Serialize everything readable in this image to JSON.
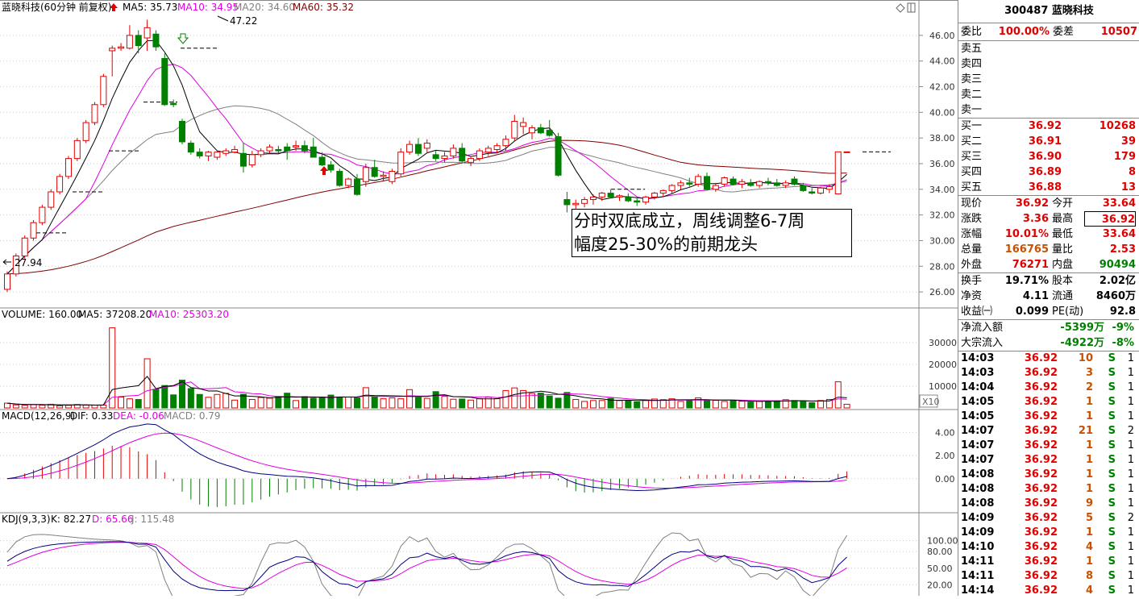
{
  "main_chart": {
    "title": "蓝晓科技(60分钟 前复权)",
    "ma5": "MA5: 35.73",
    "ma10": "MA10: 34.95",
    "ma20": "MA20: 34.60",
    "ma60": "MA60: 35.32",
    "high_label": "47.22",
    "low_label": "27.94",
    "y_ticks": [
      "46.00",
      "44.00",
      "42.00",
      "40.00",
      "38.00",
      "36.00",
      "34.00",
      "32.00",
      "30.00",
      "28.00",
      "26.00"
    ],
    "annotation_line1": "分时双底成立，周线调整6-7周",
    "annotation_line2": "幅度25-30%的前期龙头"
  },
  "volume_chart": {
    "title": "VOLUME: 160.00",
    "ma5": "MA5: 37208.20",
    "ma10": "MA10: 25303.20",
    "y_ticks": [
      "30000",
      "20000",
      "10000"
    ],
    "unit": "X10"
  },
  "macd_chart": {
    "title": "MACD(12,26,9)",
    "dif": "DIF: 0.33",
    "dea": "DEA: -0.06",
    "macd": "MACD: 0.79",
    "y_ticks": [
      "4.00",
      "2.00",
      "0.00"
    ]
  },
  "kdj_chart": {
    "title": "KDJ(9,3,3)",
    "k": "K: 82.27",
    "d": "D: 65.66",
    "j": "J: 115.48",
    "y_ticks": [
      "100.00",
      "80.00",
      "50.00",
      "20.00"
    ]
  },
  "quote": {
    "header": "300487 蓝晓科技",
    "weibi_label": "委比",
    "weibi": "100.00%",
    "weicha_label": "委差",
    "weicha": "10507",
    "asks": [
      {
        "label": "卖五",
        "price": "",
        "vol": ""
      },
      {
        "label": "卖四",
        "price": "",
        "vol": ""
      },
      {
        "label": "卖三",
        "price": "",
        "vol": ""
      },
      {
        "label": "卖二",
        "price": "",
        "vol": ""
      },
      {
        "label": "卖一",
        "price": "",
        "vol": ""
      }
    ],
    "bids": [
      {
        "label": "买一",
        "price": "36.92",
        "vol": "10268"
      },
      {
        "label": "买二",
        "price": "36.91",
        "vol": "39"
      },
      {
        "label": "买三",
        "price": "36.90",
        "vol": "179"
      },
      {
        "label": "买四",
        "price": "36.89",
        "vol": "8"
      },
      {
        "label": "买五",
        "price": "36.88",
        "vol": "13"
      }
    ],
    "stats": [
      {
        "l1": "现价",
        "v1": "36.92",
        "l2": "今开",
        "v2": "33.64",
        "c1": "red",
        "c2": "red"
      },
      {
        "l1": "涨跌",
        "v1": "3.36",
        "l2": "最高",
        "v2": "36.92",
        "c1": "red",
        "c2": "red"
      },
      {
        "l1": "涨幅",
        "v1": "10.01%",
        "l2": "最低",
        "v2": "33.64",
        "c1": "red",
        "c2": "red"
      },
      {
        "l1": "总量",
        "v1": "166765",
        "l2": "量比",
        "v2": "2.53",
        "c1": "orange",
        "c2": "red"
      },
      {
        "l1": "外盘",
        "v1": "76271",
        "l2": "内盘",
        "v2": "90494",
        "c1": "red",
        "c2": "green"
      }
    ],
    "fund": [
      {
        "l1": "换手",
        "v1": "19.71%",
        "l2": "股本",
        "v2": "2.02亿"
      },
      {
        "l1": "净资",
        "v1": "4.11",
        "l2": "流通",
        "v2": "8460万"
      },
      {
        "l1": "收益㈠",
        "v1": "0.099",
        "l2": "PE(动)",
        "v2": "92.8"
      }
    ],
    "flow": [
      {
        "label": "净流入额",
        "value": "-5399万",
        "pct": "-9%"
      },
      {
        "label": "大宗流入",
        "value": "-4922万",
        "pct": "-8%"
      }
    ],
    "ticks": [
      {
        "time": "14:03",
        "price": "36.92",
        "vol": "10",
        "side": "S",
        "n": "1"
      },
      {
        "time": "14:03",
        "price": "36.92",
        "vol": "3",
        "side": "S",
        "n": "1"
      },
      {
        "time": "14:04",
        "price": "36.92",
        "vol": "2",
        "side": "S",
        "n": "1"
      },
      {
        "time": "14:05",
        "price": "36.92",
        "vol": "1",
        "side": "S",
        "n": "1"
      },
      {
        "time": "14:05",
        "price": "36.92",
        "vol": "1",
        "side": "S",
        "n": "1"
      },
      {
        "time": "14:07",
        "price": "36.92",
        "vol": "21",
        "side": "S",
        "n": "2"
      },
      {
        "time": "14:07",
        "price": "36.92",
        "vol": "1",
        "side": "S",
        "n": "1"
      },
      {
        "time": "14:07",
        "price": "36.92",
        "vol": "1",
        "side": "S",
        "n": "1"
      },
      {
        "time": "14:08",
        "price": "36.92",
        "vol": "1",
        "side": "S",
        "n": "1"
      },
      {
        "time": "14:08",
        "price": "36.92",
        "vol": "1",
        "side": "S",
        "n": "1"
      },
      {
        "time": "14:08",
        "price": "36.92",
        "vol": "9",
        "side": "S",
        "n": "1"
      },
      {
        "time": "14:09",
        "price": "36.92",
        "vol": "5",
        "side": "S",
        "n": "2"
      },
      {
        "time": "14:09",
        "price": "36.92",
        "vol": "1",
        "side": "S",
        "n": "1"
      },
      {
        "time": "14:10",
        "price": "36.92",
        "vol": "4",
        "side": "S",
        "n": "1"
      },
      {
        "time": "14:11",
        "price": "36.92",
        "vol": "1",
        "side": "S",
        "n": "1"
      },
      {
        "time": "14:11",
        "price": "36.92",
        "vol": "8",
        "side": "S",
        "n": "1"
      },
      {
        "time": "14:14",
        "price": "36.92",
        "vol": "4",
        "side": "S",
        "n": "1"
      }
    ]
  },
  "colors": {
    "up": "#e00000",
    "down": "#008000",
    "ma5": "#000000",
    "ma10": "#e000e0",
    "ma20": "#808080",
    "ma60": "#800000",
    "dif": "#000080",
    "dea": "#e000e0"
  },
  "chart_data": [
    {
      "type": "candlestick",
      "title": "蓝晓科技(60分钟 前复权)",
      "ylim": [
        25,
        47.5
      ],
      "ohlc": [
        [
          26.2,
          27.6,
          26.0,
          27.4
        ],
        [
          27.4,
          29.0,
          27.2,
          28.8
        ],
        [
          28.8,
          30.4,
          28.6,
          30.2
        ],
        [
          30.2,
          31.6,
          30.0,
          31.4
        ],
        [
          31.4,
          32.8,
          31.2,
          32.6
        ],
        [
          32.6,
          34.0,
          32.4,
          33.8
        ],
        [
          33.8,
          35.2,
          33.6,
          35.0
        ],
        [
          35.0,
          36.6,
          34.8,
          36.4
        ],
        [
          36.4,
          38.0,
          36.2,
          37.8
        ],
        [
          37.8,
          39.4,
          37.6,
          39.2
        ],
        [
          39.2,
          40.8,
          39.0,
          40.6
        ],
        [
          40.6,
          43.0,
          40.4,
          42.8
        ],
        [
          44.8,
          45.2,
          42.8,
          45.0
        ],
        [
          45.0,
          45.4,
          44.8,
          45.1
        ],
        [
          45.0,
          46.8,
          44.9,
          46.0
        ],
        [
          46.0,
          46.4,
          44.6,
          45.2
        ],
        [
          45.8,
          47.22,
          44.8,
          46.6
        ],
        [
          46.1,
          46.4,
          44.8,
          45.1
        ],
        [
          44.2,
          44.6,
          40.5,
          40.6
        ],
        [
          40.7,
          41.0,
          40.4,
          40.6
        ],
        [
          39.3,
          39.5,
          37.5,
          37.7
        ],
        [
          37.6,
          37.8,
          36.7,
          36.9
        ],
        [
          36.9,
          37.2,
          36.4,
          36.6
        ],
        [
          36.6,
          37.0,
          36.2,
          36.9
        ],
        [
          36.5,
          37.0,
          36.3,
          36.9
        ],
        [
          36.8,
          37.2,
          36.6,
          37.0
        ],
        [
          36.9,
          37.4,
          36.8,
          37.1
        ],
        [
          36.8,
          37.6,
          35.3,
          35.8
        ],
        [
          35.9,
          37.0,
          35.7,
          36.7
        ],
        [
          36.7,
          37.2,
          36.5,
          37.0
        ],
        [
          37.0,
          37.5,
          36.8,
          37.3
        ],
        [
          37.1,
          37.4,
          36.8,
          37.0
        ],
        [
          37.3,
          37.6,
          36.3,
          37.0
        ],
        [
          37.3,
          37.8,
          37.0,
          37.4
        ],
        [
          37.4,
          37.8,
          36.8,
          37.0
        ],
        [
          37.3,
          38.0,
          36.5,
          36.5
        ],
        [
          36.5,
          36.9,
          35.8,
          35.9
        ],
        [
          35.9,
          36.2,
          35.3,
          35.5
        ],
        [
          35.4,
          35.6,
          34.2,
          34.3
        ],
        [
          34.3,
          34.9,
          34.1,
          34.8
        ],
        [
          34.8,
          35.2,
          33.5,
          33.6
        ],
        [
          34.6,
          36.0,
          34.2,
          35.7
        ],
        [
          35.7,
          36.3,
          34.9,
          35.0
        ],
        [
          35.0,
          35.4,
          34.6,
          35.1
        ],
        [
          34.6,
          35.6,
          34.4,
          35.4
        ],
        [
          35.2,
          37.2,
          35.0,
          36.9
        ],
        [
          36.9,
          37.8,
          36.7,
          37.5
        ],
        [
          37.5,
          38.0,
          36.6,
          36.8
        ],
        [
          37.2,
          37.9,
          36.8,
          37.6
        ],
        [
          36.7,
          37.0,
          36.2,
          36.4
        ],
        [
          36.4,
          36.9,
          36.1,
          36.6
        ],
        [
          36.6,
          37.5,
          36.4,
          37.2
        ],
        [
          37.2,
          37.6,
          36.0,
          36.2
        ],
        [
          36.1,
          36.6,
          35.8,
          36.4
        ],
        [
          36.4,
          37.2,
          36.2,
          37.0
        ],
        [
          36.9,
          37.4,
          36.6,
          37.2
        ],
        [
          37.1,
          37.6,
          36.8,
          37.4
        ],
        [
          37.4,
          38.2,
          37.0,
          37.9
        ],
        [
          38.0,
          39.8,
          37.8,
          39.3
        ],
        [
          38.9,
          39.6,
          38.3,
          39.2
        ],
        [
          38.4,
          39.0,
          37.9,
          38.8
        ],
        [
          38.8,
          39.1,
          38.3,
          38.4
        ],
        [
          38.6,
          39.4,
          38.1,
          38.2
        ],
        [
          38.1,
          38.4,
          35.0,
          35.1
        ],
        [
          33.2,
          33.8,
          32.2,
          32.8
        ],
        [
          32.8,
          33.2,
          32.4,
          32.9
        ],
        [
          32.9,
          33.4,
          32.6,
          33.2
        ],
        [
          33.2,
          33.6,
          32.8,
          33.4
        ],
        [
          33.4,
          33.8,
          33.1,
          33.7
        ],
        [
          33.7,
          34.0,
          33.3,
          33.4
        ],
        [
          33.4,
          33.6,
          33.1,
          33.5
        ],
        [
          33.4,
          33.7,
          33.0,
          33.1
        ],
        [
          33.1,
          33.4,
          32.7,
          33.0
        ],
        [
          33.0,
          33.5,
          32.8,
          33.4
        ],
        [
          33.4,
          33.8,
          33.2,
          33.7
        ],
        [
          33.7,
          34.0,
          33.4,
          33.9
        ],
        [
          33.9,
          34.4,
          33.7,
          34.3
        ],
        [
          34.3,
          34.7,
          34.0,
          34.5
        ],
        [
          34.5,
          34.9,
          34.2,
          34.4
        ],
        [
          34.4,
          35.2,
          34.2,
          35.0
        ],
        [
          35.0,
          35.3,
          33.9,
          34.0
        ],
        [
          34.0,
          34.5,
          33.8,
          34.3
        ],
        [
          34.4,
          35.0,
          34.2,
          34.9
        ],
        [
          34.8,
          35.0,
          34.3,
          34.4
        ],
        [
          34.4,
          34.8,
          34.1,
          34.6
        ],
        [
          34.5,
          34.8,
          34.2,
          34.3
        ],
        [
          34.3,
          34.7,
          34.1,
          34.6
        ],
        [
          34.6,
          34.9,
          34.3,
          34.5
        ],
        [
          34.5,
          34.8,
          34.2,
          34.3
        ],
        [
          34.3,
          34.7,
          34.1,
          34.5
        ],
        [
          34.8,
          35.0,
          34.3,
          34.4
        ],
        [
          34.3,
          34.5,
          33.8,
          33.9
        ],
        [
          33.8,
          34.1,
          33.6,
          33.7
        ],
        [
          33.7,
          34.2,
          33.6,
          34.1
        ],
        [
          34.0,
          34.4,
          33.7,
          34.2
        ],
        [
          33.64,
          36.92,
          33.64,
          36.92
        ],
        [
          36.92,
          36.92,
          36.92,
          36.92
        ]
      ],
      "volume": [
        2200,
        1400,
        1200,
        1500,
        1300,
        1700,
        1000,
        1200,
        1600,
        1300,
        1300,
        1300,
        36800,
        5000,
        4200,
        3900,
        22600,
        8600,
        10300,
        6000,
        12800,
        8900,
        6200,
        4900,
        6200,
        6700,
        3600,
        6300,
        3900,
        4800,
        4500,
        5300,
        6800,
        3400,
        5200,
        4400,
        5000,
        5900,
        4700,
        5000,
        4600,
        9300,
        5000,
        4200,
        4600,
        4200,
        8400,
        4800,
        4400,
        7500,
        5300,
        4000,
        4100,
        3600,
        4200,
        5000,
        4300,
        8000,
        9200,
        8000,
        6600,
        6800,
        5500,
        4500,
        7100,
        3900,
        3000,
        3400,
        3400,
        4400,
        3400,
        3200,
        2800,
        3600,
        4100,
        3800,
        4200,
        3000,
        3600,
        4600,
        3500,
        3500,
        3000,
        3300,
        3100,
        2700,
        3000,
        3100,
        3300,
        3800,
        3400,
        3100,
        2400,
        3400,
        3900,
        12000,
        1700
      ],
      "ma_labels": [
        "MA5: 35.73",
        "MA10: 34.95",
        "MA20: 34.60",
        "MA60: 35.32"
      ]
    },
    {
      "type": "bar",
      "title": "VOLUME: 160.00",
      "ylim": [
        0,
        40000
      ]
    },
    {
      "type": "line",
      "title": "MACD(12,26,9)",
      "ylim": [
        -2.8,
        5.0
      ]
    },
    {
      "type": "line",
      "title": "KDJ(9,3,3)",
      "ylim": [
        0,
        130
      ]
    }
  ]
}
